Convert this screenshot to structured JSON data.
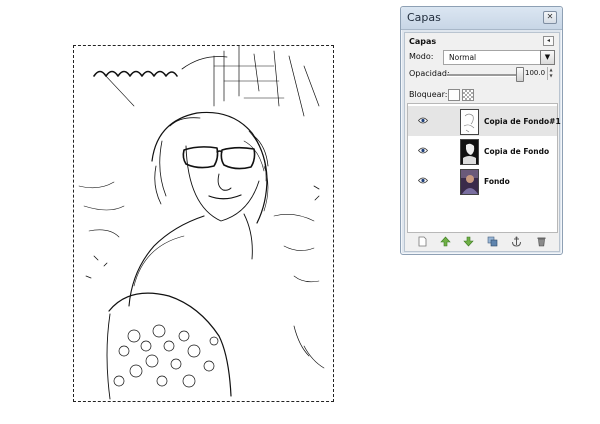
{
  "dialog": {
    "title": "Capas",
    "panel_label": "Capas",
    "mode_label": "Modo:",
    "mode_value": "Normal",
    "opacity_label": "Opacidad:",
    "opacity_value": "100.0",
    "opacity_level_percent": 100,
    "lock_label": "Bloquear:"
  },
  "layers": [
    {
      "name": "Copia de Fondo#1",
      "visible": true,
      "selected": true,
      "thumb": "white-sketch"
    },
    {
      "name": "Copia de Fondo",
      "visible": true,
      "selected": false,
      "thumb": "black-sketch"
    },
    {
      "name": "Fondo",
      "visible": true,
      "selected": false,
      "thumb": "photo"
    }
  ],
  "toolbar": {
    "icons": [
      "new-layer-icon",
      "raise-layer-icon",
      "lower-layer-icon",
      "duplicate-layer-icon",
      "anchor-layer-icon",
      "delete-layer-icon"
    ]
  }
}
